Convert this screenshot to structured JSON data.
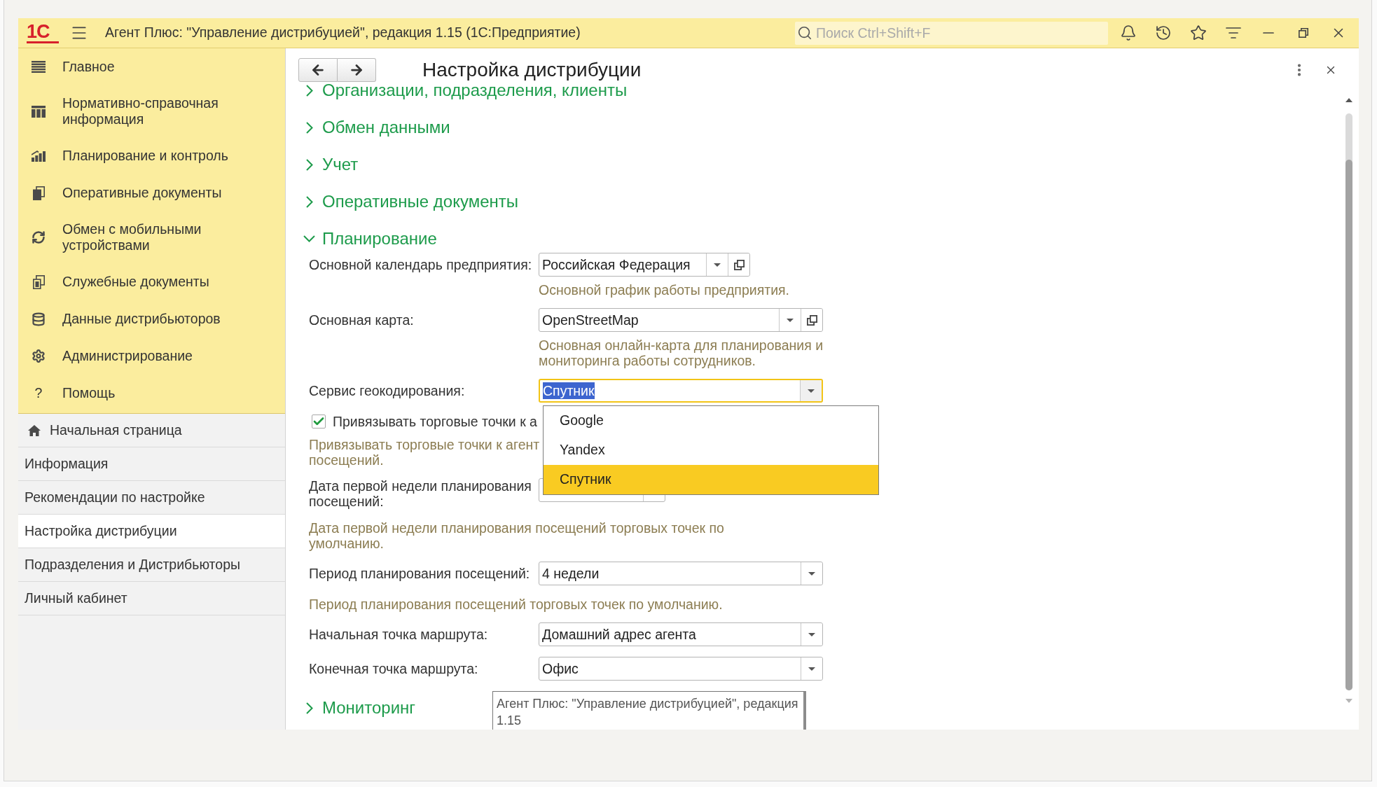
{
  "window": {
    "logo": "1С",
    "title": "Агент Плюс: \"Управление дистрибуцией\", редакция 1.15 (1С:Предприятие)",
    "search": {
      "placeholder": "Поиск Ctrl+Shift+F"
    }
  },
  "sections_panel": [
    {
      "label": "Главное"
    },
    {
      "label": "Нормативно-справочная информация"
    },
    {
      "label": "Планирование и контроль"
    },
    {
      "label": "Оперативные документы"
    },
    {
      "label": "Обмен с мобильными устройствами"
    },
    {
      "label": "Служебные документы"
    },
    {
      "label": "Данные дистрибьюторов"
    },
    {
      "label": "Администрирование"
    },
    {
      "label": "Помощь",
      "glyph": "?"
    }
  ],
  "nav_panel": [
    {
      "kind": "home",
      "label": "Начальная страница",
      "selected": false
    },
    {
      "kind": "page",
      "label": "Информация",
      "selected": false
    },
    {
      "kind": "page",
      "label": "Рекомендации по настройке",
      "selected": false
    },
    {
      "kind": "page",
      "label": "Настройка дистрибуции",
      "selected": true
    },
    {
      "kind": "page",
      "label": "Подразделения и Дистрибьюторы",
      "selected": false
    },
    {
      "kind": "page",
      "label": "Личный кабинет",
      "selected": false
    }
  ],
  "form": {
    "title": "Настройка дистрибуции",
    "sections": [
      {
        "title": "Организации, подразделения, клиенты",
        "expanded": false
      },
      {
        "title": "Обмен данными",
        "expanded": false
      },
      {
        "title": "Учет",
        "expanded": false
      },
      {
        "title": "Оперативные документы",
        "expanded": false
      },
      {
        "title": "Планирование",
        "expanded": true,
        "fields": [
          {
            "kind": "select",
            "label": "Основной календарь предприятия:",
            "value": "Российская Федерация",
            "focused": false,
            "open_button": true,
            "hint": "Основной график работы предприятия."
          },
          {
            "kind": "select",
            "label": "Основная карта:",
            "value": "OpenStreetMap",
            "focused": false,
            "open_button": true,
            "hint": "Основная онлайн-карта для планирования и мониторинга работы сотрудников."
          },
          {
            "kind": "select",
            "label": "Сервис геокодирования:",
            "value": "Спутник",
            "focused": true,
            "open_button": false,
            "dropdown": {
              "options": [
                {
                  "label": "Google",
                  "selected": false
                },
                {
                  "label": "Yandex",
                  "selected": false
                },
                {
                  "label": "Спутник",
                  "selected": true
                }
              ]
            }
          },
          {
            "kind": "checkbox",
            "label": "Привязывать торговые точки к а",
            "checked": true,
            "hint_lines": [
              "Привязывать торговые точки к агент",
              "посещений."
            ]
          },
          {
            "kind": "date",
            "label": "Дата первой недели планирования посещений:",
            "hint": "Дата первой недели планирования посещений торговых точек по умолчанию."
          },
          {
            "kind": "select",
            "label": "Период планирования посещений:",
            "value": "4 недели",
            "focused": false,
            "open_button": false,
            "hint": "Период планирования посещений торговых точек по умолчанию."
          },
          {
            "kind": "select",
            "label": "Начальная точка маршрута:",
            "value": "Домашний адрес агента",
            "focused": false,
            "open_button": false
          },
          {
            "kind": "select",
            "label": "Конечная точка маршрута:",
            "value": "Офис",
            "focused": false,
            "open_button": false
          }
        ]
      },
      {
        "title": "Мониторинг",
        "expanded": false
      }
    ]
  },
  "tooltip": {
    "text": "Агент Плюс: \"Управление дистрибуцией\", редакция 1.15"
  }
}
